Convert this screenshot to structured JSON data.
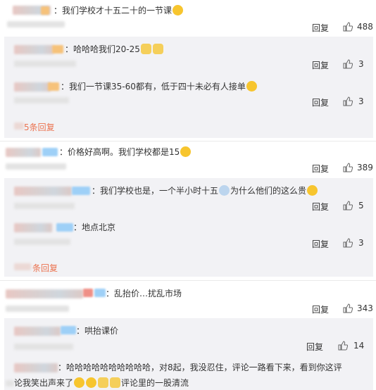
{
  "actions": {
    "reply": "回复"
  },
  "comments": [
    {
      "text": "我们学校才十五二十的一节课",
      "likes": "488",
      "replies": [
        {
          "text": "哈哈哈我们20-25",
          "likes": "3"
        },
        {
          "text": "我们一节课35-60都有，低于四十未必有人接单",
          "likes": "3"
        }
      ],
      "more": "5条回复"
    },
    {
      "text": "价格好高啊。我们学校都是15",
      "likes": "389",
      "replies": [
        {
          "text": "我们学校也是，一个半小时十五",
          "text_b": "为什么他们的这么贵",
          "likes": "5"
        },
        {
          "text": "地点北京",
          "likes": "3"
        }
      ],
      "more": "条回复"
    },
    {
      "text": "乱抬价…扰乱市场",
      "likes": "343",
      "replies": [
        {
          "text": "哄抬课价",
          "likes": "14"
        },
        {
          "text": "哈哈哈哈哈哈哈哈哈哈，对8起，我没忍住，评论一路看下来，看到你这评",
          "text_b": "论我笑出声来了",
          "text_c": "评论里的一股清流"
        }
      ]
    }
  ],
  "icons": {
    "like": "thumbs-up-icon",
    "laugh_cry": "laughing-emoji-icon",
    "cat": "cat-emoji-icon",
    "sad": "crying-emoji-icon"
  }
}
